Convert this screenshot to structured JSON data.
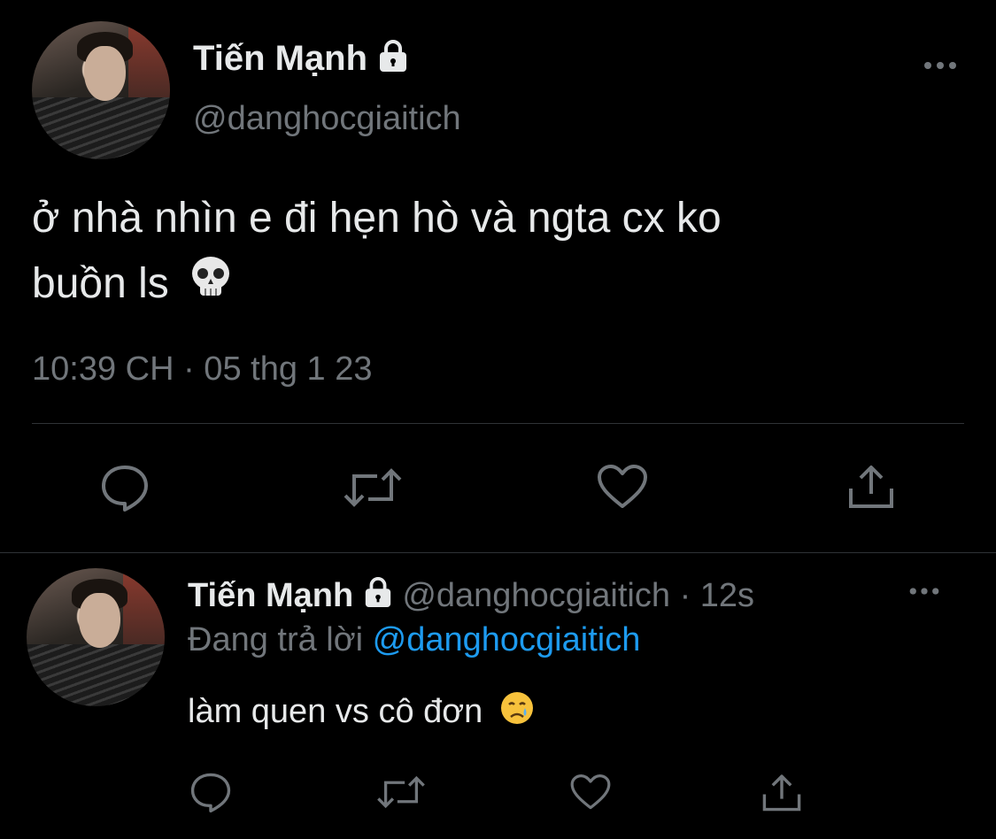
{
  "main_tweet": {
    "display_name": "Tiến Mạnh",
    "handle": "@danghocgiaitich",
    "text_line1": "ở nhà nhìn e đi hẹn hò và ngta cx ko",
    "text_line2": "buồn ls",
    "text_emoji": "skull",
    "timestamp": "10:39 CH · 05 thg 1 23"
  },
  "reply_tweet": {
    "display_name": "Tiến Mạnh",
    "handle": "@danghocgiaitich",
    "time": "· 12s",
    "replying_prefix": "Đang trả lời",
    "replying_handle": "@danghocgiaitich",
    "text": "làm quen vs cô đơn",
    "text_emoji": "crying-face"
  },
  "icons": {
    "more": "more-options-icon",
    "reply": "reply-icon",
    "retweet": "retweet-icon",
    "like": "heart-icon",
    "share": "share-icon",
    "lock": "lock-icon"
  },
  "colors": {
    "background": "#000000",
    "text": "#e7e9ea",
    "muted": "#71767b",
    "link": "#1d9bf0",
    "divider": "#2f3336"
  }
}
